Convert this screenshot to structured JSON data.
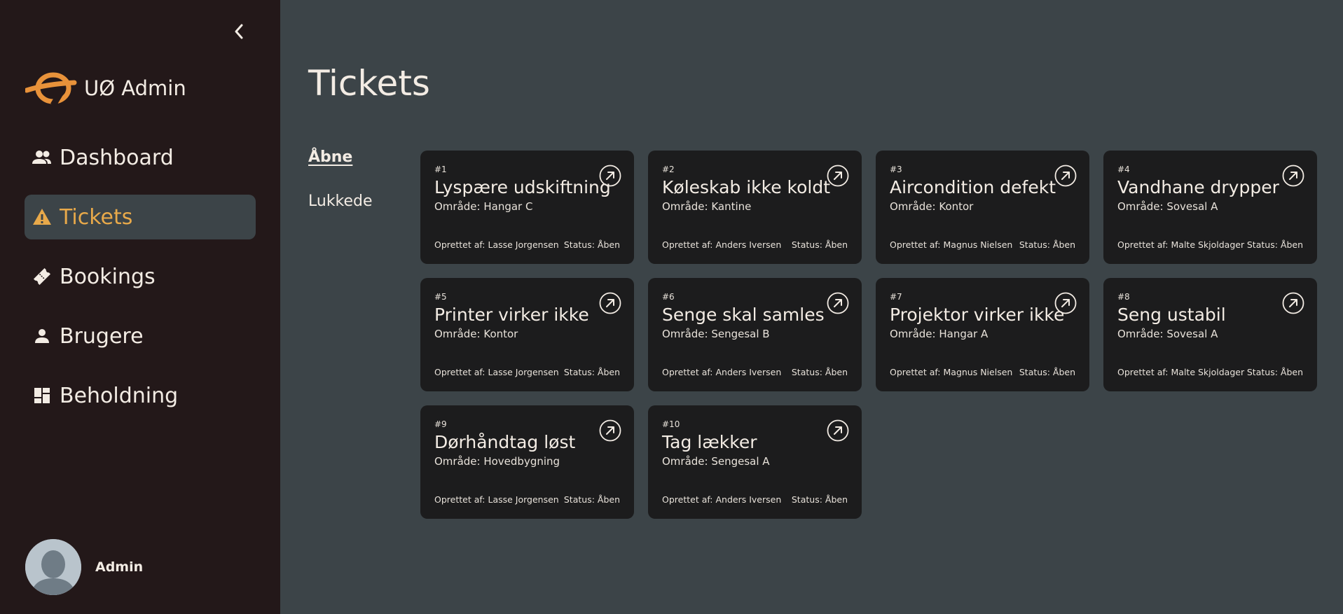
{
  "sidebar": {
    "brand_name": "UØ Admin",
    "items": [
      {
        "label": "Dashboard",
        "icon": "people-icon",
        "active": false
      },
      {
        "label": "Tickets",
        "icon": "warning-icon",
        "active": true
      },
      {
        "label": "Bookings",
        "icon": "ticket-icon",
        "active": false
      },
      {
        "label": "Brugere",
        "icon": "person-icon",
        "active": false
      },
      {
        "label": "Beholdning",
        "icon": "dashboard-grid-icon",
        "active": false
      }
    ],
    "user_name": "Admin"
  },
  "main": {
    "title": "Tickets",
    "filters": [
      {
        "label": "Åbne",
        "active": true
      },
      {
        "label": "Lukkede",
        "active": false
      }
    ],
    "tickets": [
      {
        "num": "#1",
        "title": "Lyspære udskiftning",
        "area": "Område: Hangar C",
        "creator": "Oprettet af: Lasse Jorgensen",
        "status": "Status: Åben"
      },
      {
        "num": "#2",
        "title": "Køleskab ikke koldt",
        "area": "Område: Kantine",
        "creator": "Oprettet af: Anders Iversen",
        "status": "Status: Åben"
      },
      {
        "num": "#3",
        "title": "Aircondition defekt",
        "area": "Område: Kontor",
        "creator": "Oprettet af: Magnus Nielsen",
        "status": "Status: Åben"
      },
      {
        "num": "#4",
        "title": "Vandhane drypper",
        "area": "Område: Sovesal A",
        "creator": "Oprettet af: Malte Skjoldager",
        "status": "Status: Åben"
      },
      {
        "num": "#5",
        "title": "Printer virker ikke",
        "area": "Område: Kontor",
        "creator": "Oprettet af: Lasse Jorgensen",
        "status": "Status: Åben"
      },
      {
        "num": "#6",
        "title": "Senge skal samles",
        "area": "Område: Sengesal B",
        "creator": "Oprettet af: Anders Iversen",
        "status": "Status: Åben"
      },
      {
        "num": "#7",
        "title": "Projektor virker ikke",
        "area": "Område: Hangar A",
        "creator": "Oprettet af: Magnus Nielsen",
        "status": "Status: Åben"
      },
      {
        "num": "#8",
        "title": "Seng ustabil",
        "area": "Område: Sovesal A",
        "creator": "Oprettet af: Malte Skjoldager",
        "status": "Status: Åben"
      },
      {
        "num": "#9",
        "title": "Dørhåndtag løst",
        "area": "Område: Hovedbygning",
        "creator": "Oprettet af: Lasse Jorgensen",
        "status": "Status: Åben"
      },
      {
        "num": "#10",
        "title": "Tag lækker",
        "area": "Område: Sengesal A",
        "creator": "Oprettet af: Anders Iversen",
        "status": "Status: Åben"
      }
    ]
  },
  "colors": {
    "sidebar_bg": "#231819",
    "main_bg": "#3c4448",
    "card_bg": "#1c1c1d",
    "accent": "#e8a94a",
    "text": "#f3ece4"
  }
}
